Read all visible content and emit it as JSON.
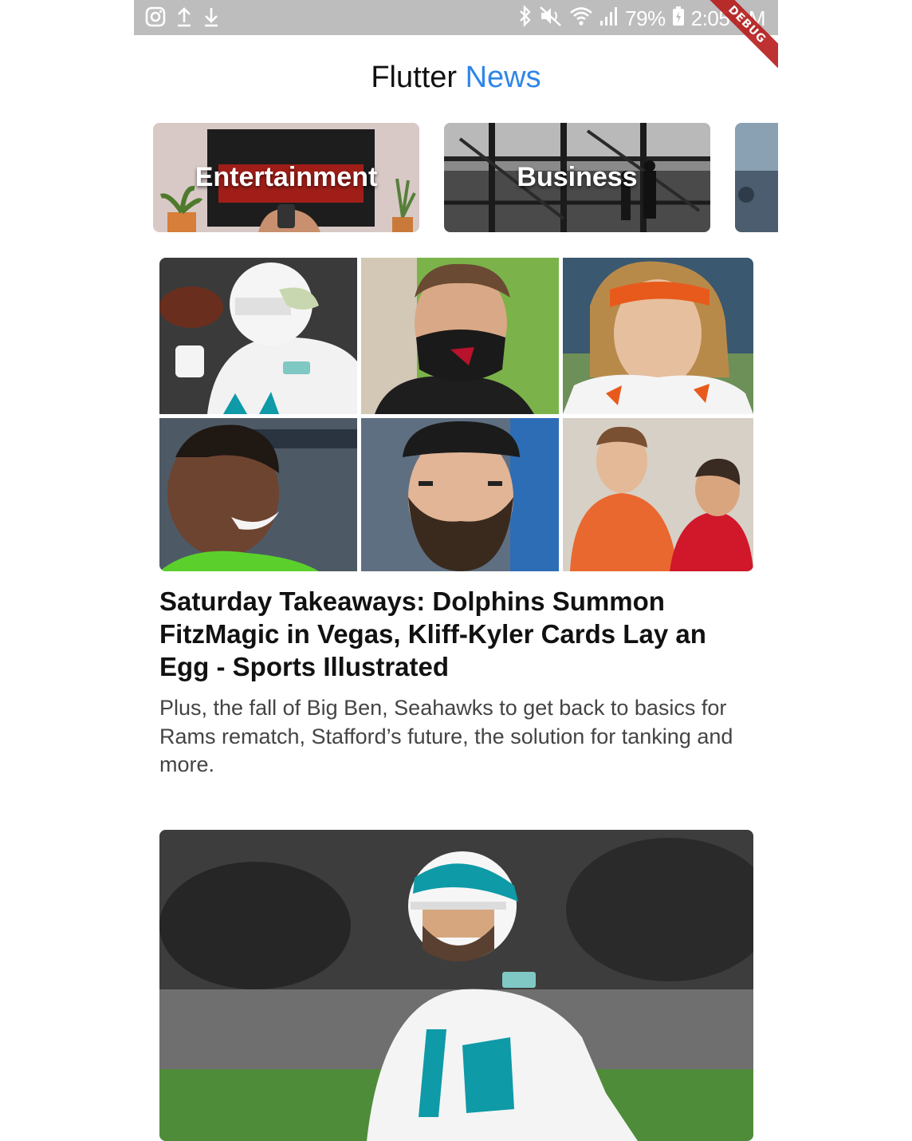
{
  "status_bar": {
    "battery": "79%",
    "time": "2:05 PM",
    "debug_label": "DEBUG",
    "left_icons": [
      "instagram-icon",
      "upload-icon",
      "download-icon"
    ],
    "right_icons": [
      "bluetooth-icon",
      "mute-icon",
      "wifi-icon",
      "signal-icon",
      "battery-icon"
    ]
  },
  "header": {
    "title_part1": "Flutter",
    "title_part2": "News",
    "accent_color": "#2f86e8"
  },
  "categories": [
    {
      "label": "Entertainment"
    },
    {
      "label": "Business"
    }
  ],
  "articles": [
    {
      "title": "Saturday Takeaways: Dolphins Summon FitzMagic in Vegas, Kliff-Kyler Cards Lay an Egg - Sports Illustrated",
      "description": "Plus, the fall of Big Ben, Seahawks to get back to basics for Rams rematch, Stafford’s future, the solution for tanking and more."
    },
    {
      "title": "",
      "description": ""
    }
  ]
}
